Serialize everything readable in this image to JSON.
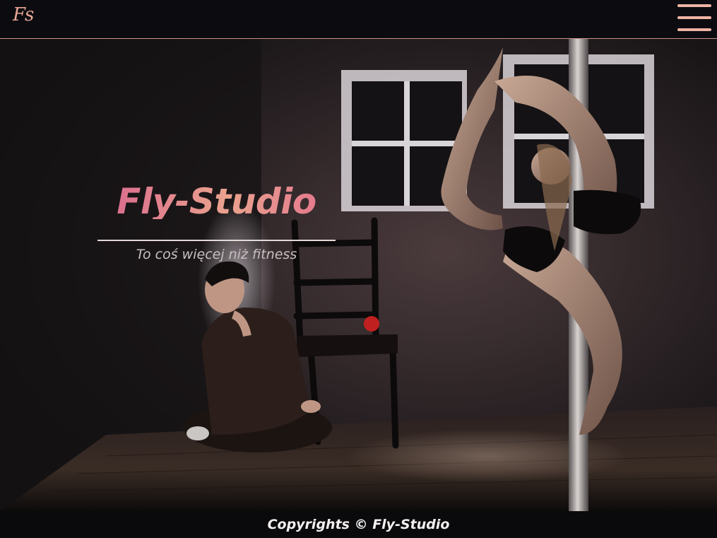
{
  "header": {
    "logo": "Fs",
    "menu_icon": "hamburger-icon",
    "accent": "#f0b3a3"
  },
  "hero": {
    "title": "Fly-Studio",
    "tagline": "To coś więcej niż fitness",
    "title_gradient": [
      "#d9668e",
      "#eaa38e",
      "#e2728d"
    ]
  },
  "footer": {
    "copyright": "Copyrights © Fly-Studio"
  }
}
